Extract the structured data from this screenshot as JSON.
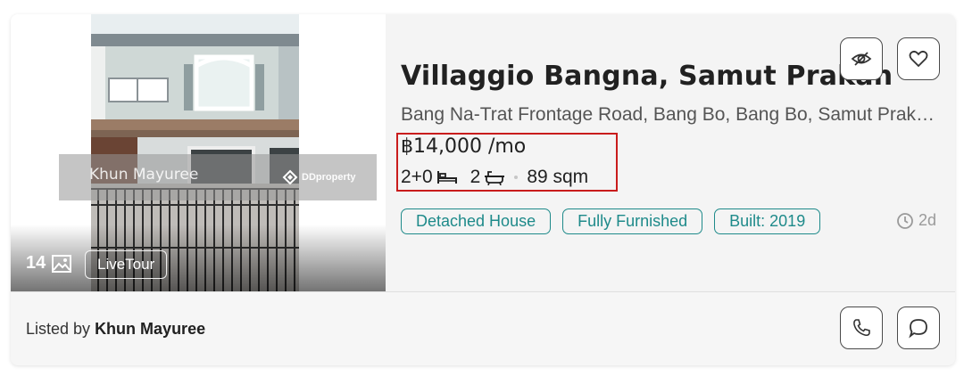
{
  "listing": {
    "title": "Villaggio Bangna, Samut Prakan",
    "address": "Bang Na-Trat Frontage Road, Bang Bo, Bang Bo, Samut Prakan",
    "price": "฿14,000 /mo",
    "beds": "2+0",
    "baths": "2",
    "area": "89 sqm",
    "tags": [
      "Detached House",
      "Fully Furnished",
      "Built: 2019"
    ],
    "posted_age": "2d",
    "highlight_color": "#c91c1c",
    "tag_color": "#1e8a8a"
  },
  "photo": {
    "count": "14",
    "live_tour_label": "LiveTour",
    "watermark_name": "Khun Mayuree",
    "watermark_brand": "DDproperty"
  },
  "actions": {
    "hide_icon": "eye-off-icon",
    "favorite_icon": "heart-icon",
    "call_icon": "phone-icon",
    "chat_icon": "chat-bubble-icon"
  },
  "footer": {
    "listed_by_prefix": "Listed by",
    "agent_name": "Khun Mayuree"
  }
}
